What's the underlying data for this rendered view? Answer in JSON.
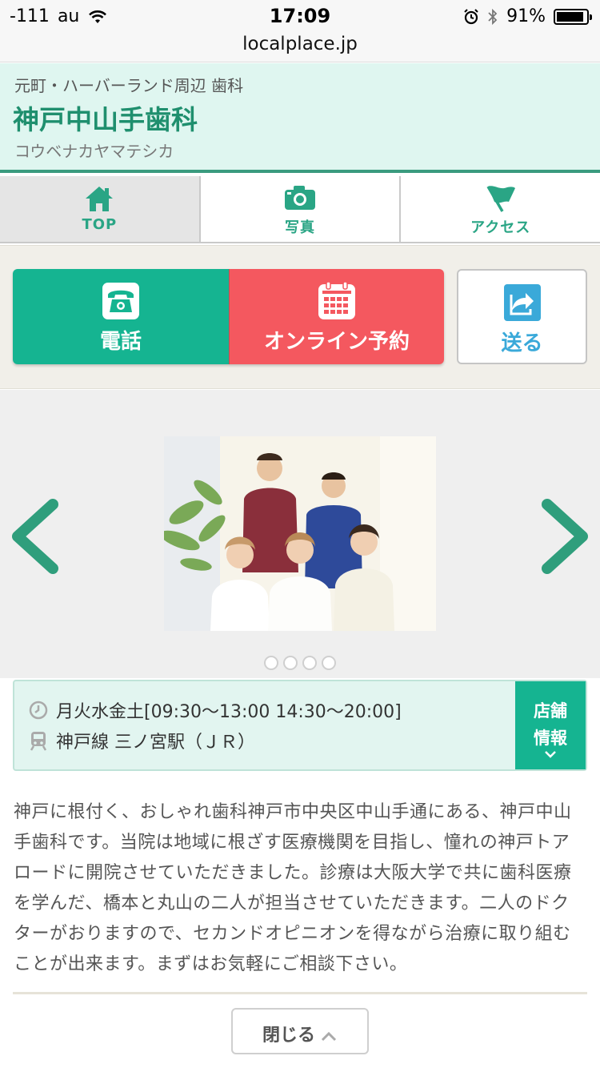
{
  "status_bar": {
    "signal": "-111",
    "carrier": "au",
    "time": "17:09",
    "battery": "91%",
    "battery_level": 0.91
  },
  "browser": {
    "url": "localplace.jp"
  },
  "header": {
    "area": "元町・ハーバーランド周辺 歯科",
    "name": "神戸中山手歯科",
    "kana": "コウベナカヤマテシカ"
  },
  "nav_tabs": [
    {
      "label": "TOP",
      "icon": "home-icon",
      "active": true
    },
    {
      "label": "写真",
      "icon": "camera-icon",
      "active": false
    },
    {
      "label": "アクセス",
      "icon": "flag-icon",
      "active": false
    }
  ],
  "actions": {
    "tel_label": "電話",
    "reserve_label": "オンライン予約",
    "send_label": "送る"
  },
  "carousel": {
    "slide_count": 4,
    "photo_icon": "staff-photo"
  },
  "info": {
    "hours": "月火水金土[09:30〜13:00 14:30〜20:00]",
    "station": "神戸線 三ノ宮駅（ＪＲ）",
    "more_label_1": "店舗",
    "more_label_2": "情報"
  },
  "description": "神戸に根付く、おしゃれ歯科神戸市中央区中山手通にある、神戸中山手歯科です。当院は地域に根ざす医療機関を目指し、憧れの神戸トアロードに開院させていただきました。診療は大阪大学で共に歯科医療を学んだ、橋本と丸山の二人が担当させていただきます。二人のドクターがおりますので、セカンドオピニオンを得ながら治療に取り組むことが出来ます。まずはお気軽にご相談下さい。",
  "close_label": "閉じる",
  "colors": {
    "accent": "#15b491",
    "reserve": "#f4585f",
    "header_bg": "#dff6f0",
    "title": "#1f8f6e"
  }
}
